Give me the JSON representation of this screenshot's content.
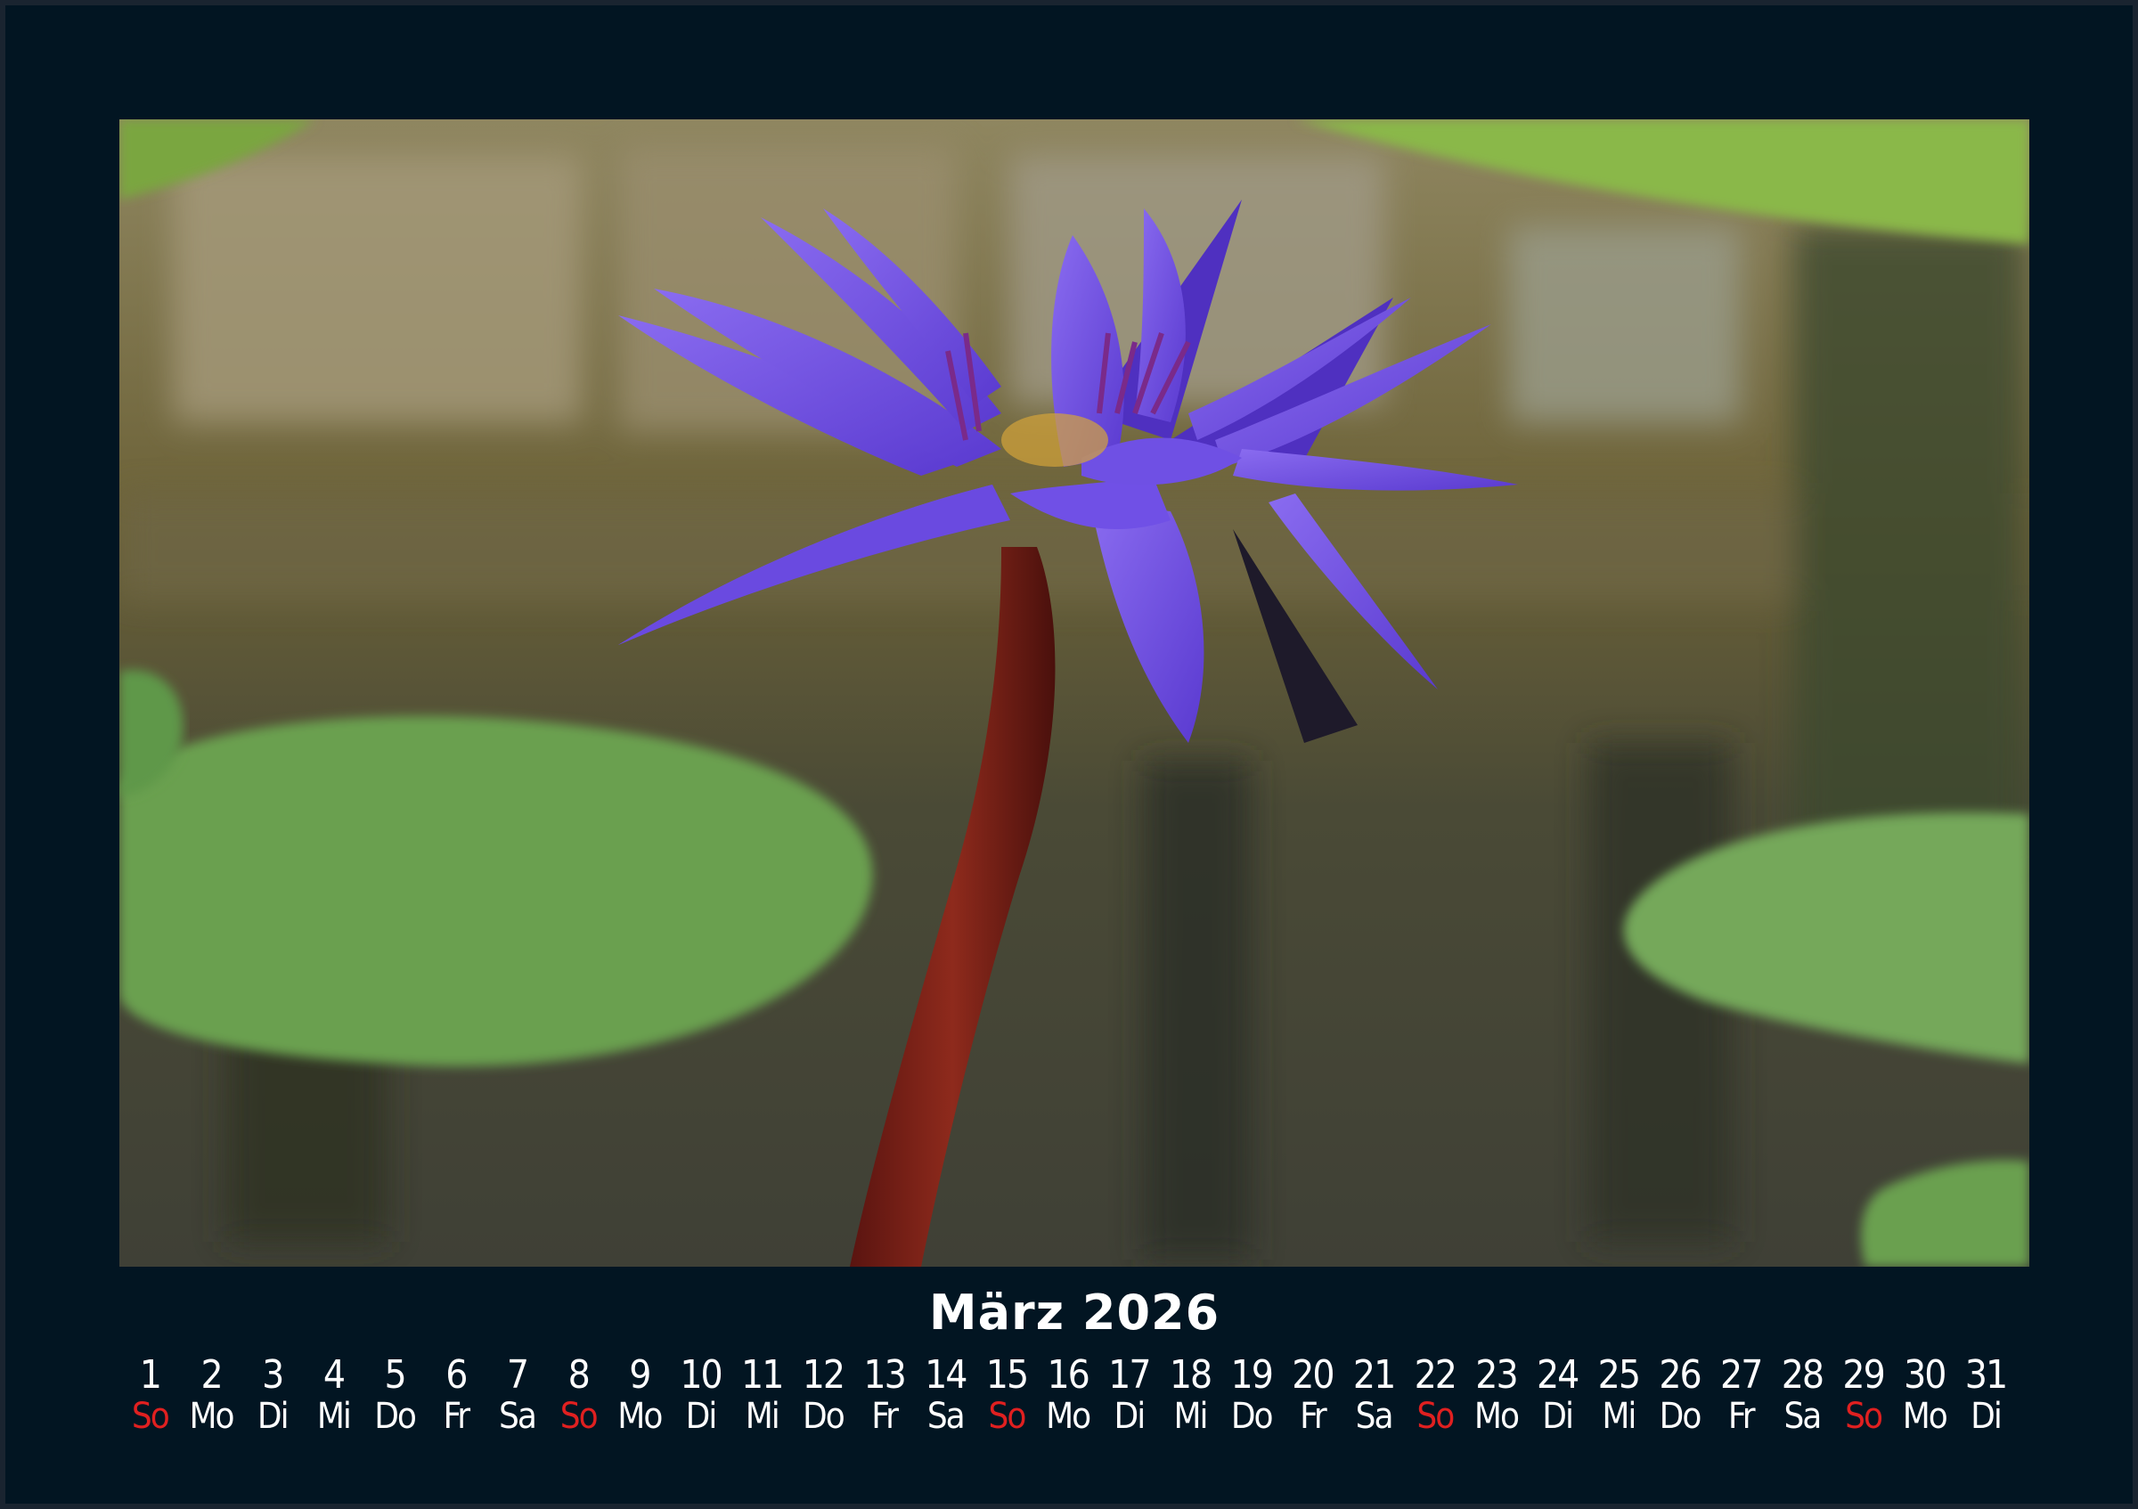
{
  "calendar": {
    "month_title": "März 2026",
    "sunday_color": "#e02020",
    "days": [
      {
        "num": "1",
        "name": "So"
      },
      {
        "num": "2",
        "name": "Mo"
      },
      {
        "num": "3",
        "name": "Di"
      },
      {
        "num": "4",
        "name": "Mi"
      },
      {
        "num": "5",
        "name": "Do"
      },
      {
        "num": "6",
        "name": "Fr"
      },
      {
        "num": "7",
        "name": "Sa"
      },
      {
        "num": "8",
        "name": "So"
      },
      {
        "num": "9",
        "name": "Mo"
      },
      {
        "num": "10",
        "name": "Di"
      },
      {
        "num": "11",
        "name": "Mi"
      },
      {
        "num": "12",
        "name": "Do"
      },
      {
        "num": "13",
        "name": "Fr"
      },
      {
        "num": "14",
        "name": "Sa"
      },
      {
        "num": "15",
        "name": "So"
      },
      {
        "num": "16",
        "name": "Mo"
      },
      {
        "num": "17",
        "name": "Di"
      },
      {
        "num": "18",
        "name": "Mi"
      },
      {
        "num": "19",
        "name": "Do"
      },
      {
        "num": "20",
        "name": "Fr"
      },
      {
        "num": "21",
        "name": "Sa"
      },
      {
        "num": "22",
        "name": "So"
      },
      {
        "num": "23",
        "name": "Mo"
      },
      {
        "num": "24",
        "name": "Di"
      },
      {
        "num": "25",
        "name": "Mi"
      },
      {
        "num": "26",
        "name": "Do"
      },
      {
        "num": "27",
        "name": "Fr"
      },
      {
        "num": "28",
        "name": "Sa"
      },
      {
        "num": "29",
        "name": "So"
      },
      {
        "num": "30",
        "name": "Mo"
      },
      {
        "num": "31",
        "name": "Di"
      }
    ]
  },
  "photo": {
    "subject": "water-lily-photo"
  }
}
